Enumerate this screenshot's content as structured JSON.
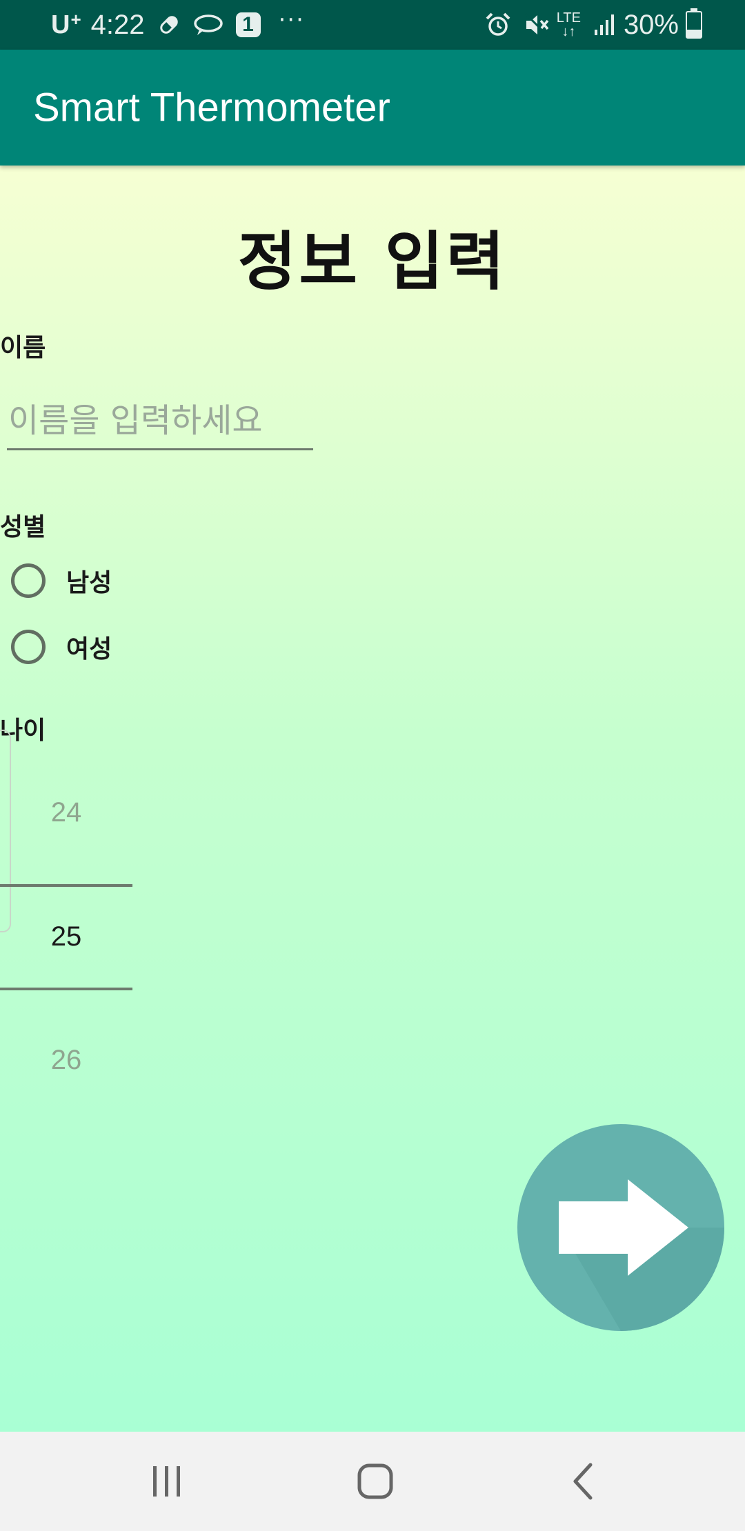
{
  "status_bar": {
    "carrier": "U",
    "carrier_plus": "+",
    "time": "4:22",
    "notification_count": "1",
    "overflow": "···",
    "network_type_top": "LTE",
    "network_type_bottom": "↓↑",
    "battery_percent": "30%",
    "battery_level": 0.3,
    "icons": [
      "pill-icon",
      "chat-bubble-icon",
      "notification-badge-icon",
      "alarm-icon",
      "mute-icon",
      "lte-icon",
      "signal-icon",
      "battery-icon"
    ],
    "background_color": "#00574b"
  },
  "app_bar": {
    "title": "Smart Thermometer",
    "background_color": "#008577"
  },
  "form": {
    "heading": "정보 입력",
    "name": {
      "label": "이름",
      "placeholder": "이름을 입력하세요",
      "value": ""
    },
    "gender": {
      "label": "성별",
      "options": [
        {
          "label": "남성",
          "selected": false
        },
        {
          "label": "여성",
          "selected": false
        }
      ]
    },
    "age": {
      "label": "나이",
      "previous": "24",
      "selected": "25",
      "next": "26"
    }
  },
  "next_button": {
    "icon": "arrow-right-icon",
    "color": "#64b2ad"
  },
  "nav_bar": {
    "buttons": [
      "recent-apps-icon",
      "home-icon",
      "back-icon"
    ]
  }
}
